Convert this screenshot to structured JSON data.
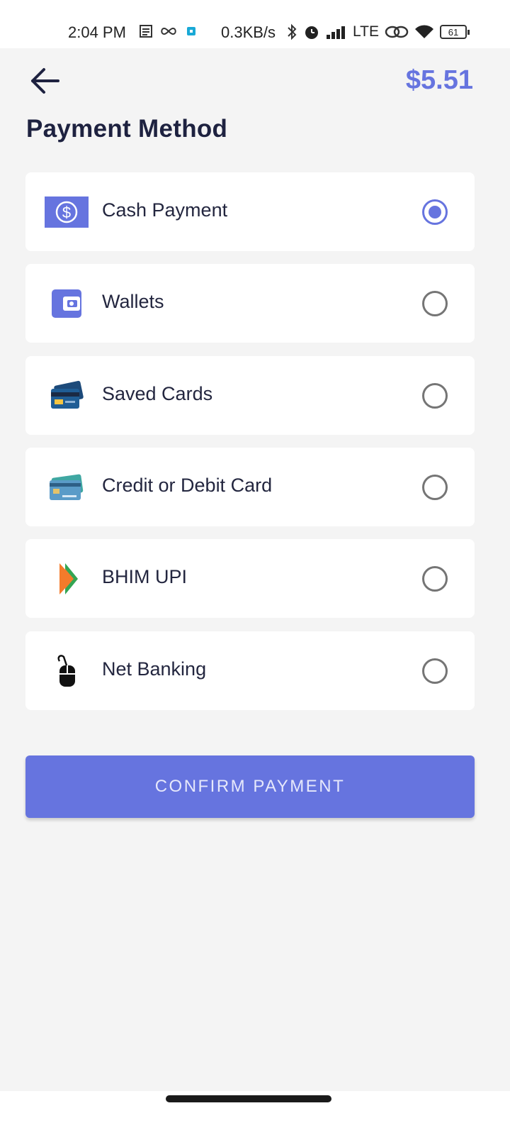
{
  "status_bar": {
    "time": "2:04 PM",
    "speed": "0.3KB/s",
    "network": "LTE",
    "battery": "61"
  },
  "header": {
    "amount": "$5.51",
    "title": "Payment Method"
  },
  "methods": [
    {
      "label": "Cash Payment",
      "icon": "cash-dollar-icon",
      "selected": true
    },
    {
      "label": "Wallets",
      "icon": "wallet-icon",
      "selected": false
    },
    {
      "label": "Saved Cards",
      "icon": "saved-cards-icon",
      "selected": false
    },
    {
      "label": "Credit or Debit Card",
      "icon": "credit-card-icon",
      "selected": false
    },
    {
      "label": "BHIM UPI",
      "icon": "bhim-upi-icon",
      "selected": false
    },
    {
      "label": "Net Banking",
      "icon": "mouse-icon",
      "selected": false
    }
  ],
  "confirm_label": "CONFIRM PAYMENT",
  "colors": {
    "accent": "#6674df",
    "background": "#f4f4f4",
    "card": "#ffffff",
    "text": "#1e2240"
  }
}
